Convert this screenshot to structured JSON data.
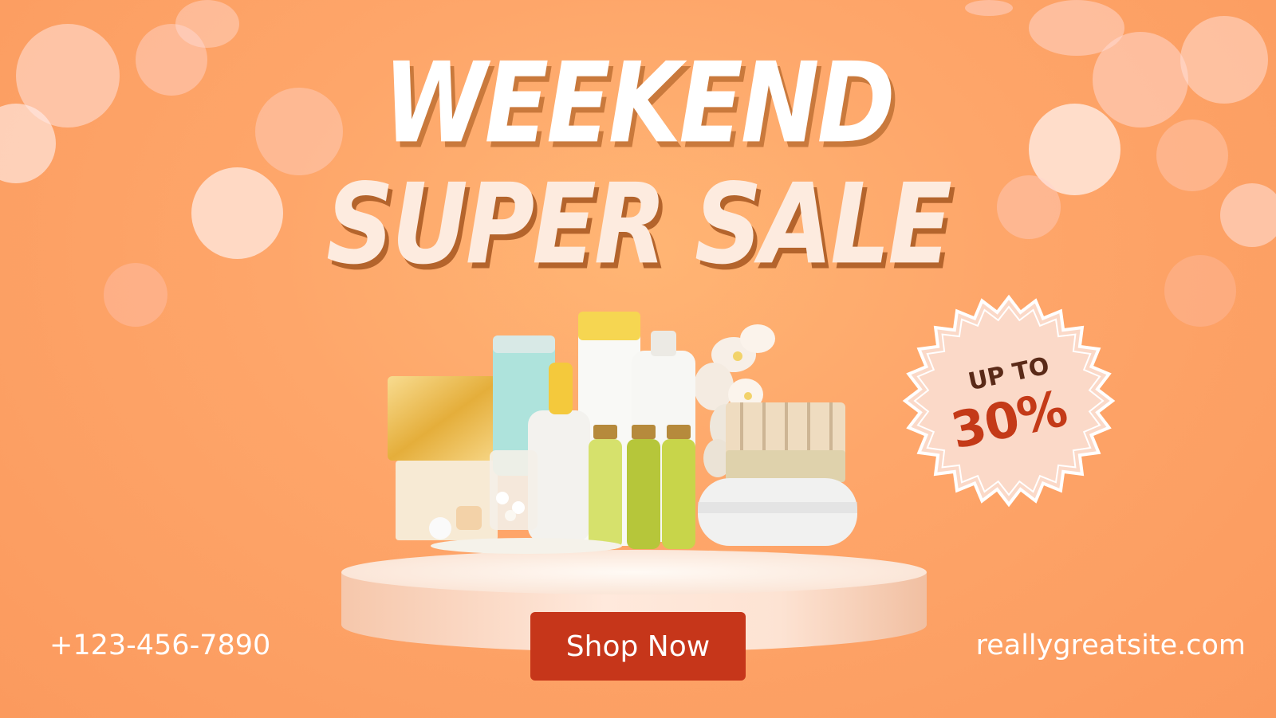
{
  "headline": {
    "line1": "WEEKEND",
    "line2": "SUPER SALE"
  },
  "badge": {
    "line1": "UP TO",
    "line2": "30%"
  },
  "cta": {
    "label": "Shop Now"
  },
  "contact": {
    "phone": "+123-456-7890",
    "website": "reallygreatsite.com"
  },
  "colors": {
    "background": "#fea66a",
    "button": "#c6361a",
    "badge_fill": "#fbd9c8",
    "badge_number": "#c43a18",
    "badge_text": "#5a2a18"
  },
  "icons": [
    "bokeh-lights",
    "spa-products-image",
    "starburst-badge"
  ]
}
